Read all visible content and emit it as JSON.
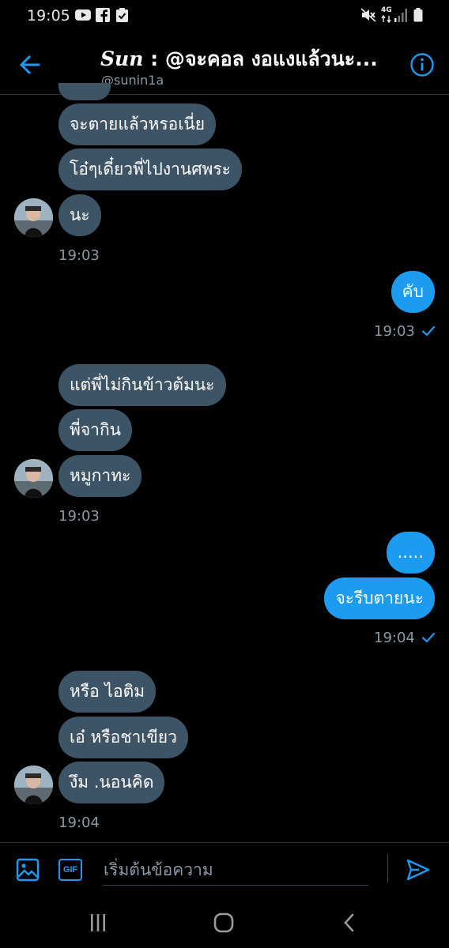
{
  "status_bar": {
    "time": "19:05",
    "network": "4G"
  },
  "header": {
    "name": "Sun",
    "title_rest": " : @จะคอล งอแงแล้วนะ...",
    "handle": "@sunin1a"
  },
  "messages": {
    "m1": "จะตายแล้วหรอเนี่ย",
    "m2": "โอ๋ๆเดี๋ยวพี่ไปงานศพระ",
    "m3": "นะ",
    "t1": "19:03",
    "m4": "คับ",
    "t2": "19:03",
    "m5": "แต่พี่ไม่กินข้าวต้มนะ",
    "m6": "พี่จากิน",
    "m7": "หมูกาทะ",
    "t3": "19:03",
    "m8": ".....",
    "m9": "จะรีบตายนะ",
    "t4": "19:04",
    "m10": "หรือ ไอติม",
    "m11": "เอ๋ หรือชาเขียว",
    "m12": "งึม .นอนคิด",
    "t5": "19:04"
  },
  "composer": {
    "placeholder": "เริ่มต้นข้อความ",
    "gif_label": "GIF"
  },
  "colors": {
    "accent": "#1d9bf0",
    "incoming_bubble": "#3d5466",
    "background": "#000000"
  },
  "icons": [
    "back-arrow-icon",
    "info-icon",
    "image-icon",
    "gif-icon",
    "send-icon",
    "recents-icon",
    "home-icon",
    "back-icon"
  ]
}
